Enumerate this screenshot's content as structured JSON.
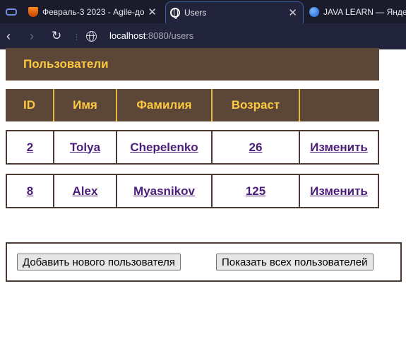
{
  "browser": {
    "tabs": [
      {
        "label": "",
        "icon": "gamepad-icon"
      },
      {
        "label": "Февраль-3 2023 - Agile-до",
        "icon": "orange-favicon-icon"
      },
      {
        "label": "Users",
        "icon": "globe-icon",
        "active": true
      },
      {
        "label": "JAVA LEARN — Яндекс",
        "icon": "yandex-favicon-icon"
      }
    ],
    "tab_close": "✕",
    "url_host": "localhost",
    "url_rest": ":8080/users"
  },
  "page": {
    "title": "Пользователи",
    "columns": {
      "id": "ID",
      "name": "Имя",
      "last_name": "Фамилия",
      "age": "Возраст",
      "action": ""
    },
    "rows": [
      {
        "id": "2",
        "name": "Tolya",
        "last_name": "Chepelenko",
        "age": "26",
        "action": "Изменить"
      },
      {
        "id": "8",
        "name": "Alex",
        "last_name": "Myasnikov",
        "age": "125",
        "action": "Изменить"
      }
    ],
    "buttons": {
      "add": "Добавить нового пользователя",
      "show_all": "Показать всех пользователей"
    }
  },
  "colors": {
    "header_bg": "#5c4638",
    "header_text": "#fdc940",
    "link": "#4a1e7a"
  }
}
